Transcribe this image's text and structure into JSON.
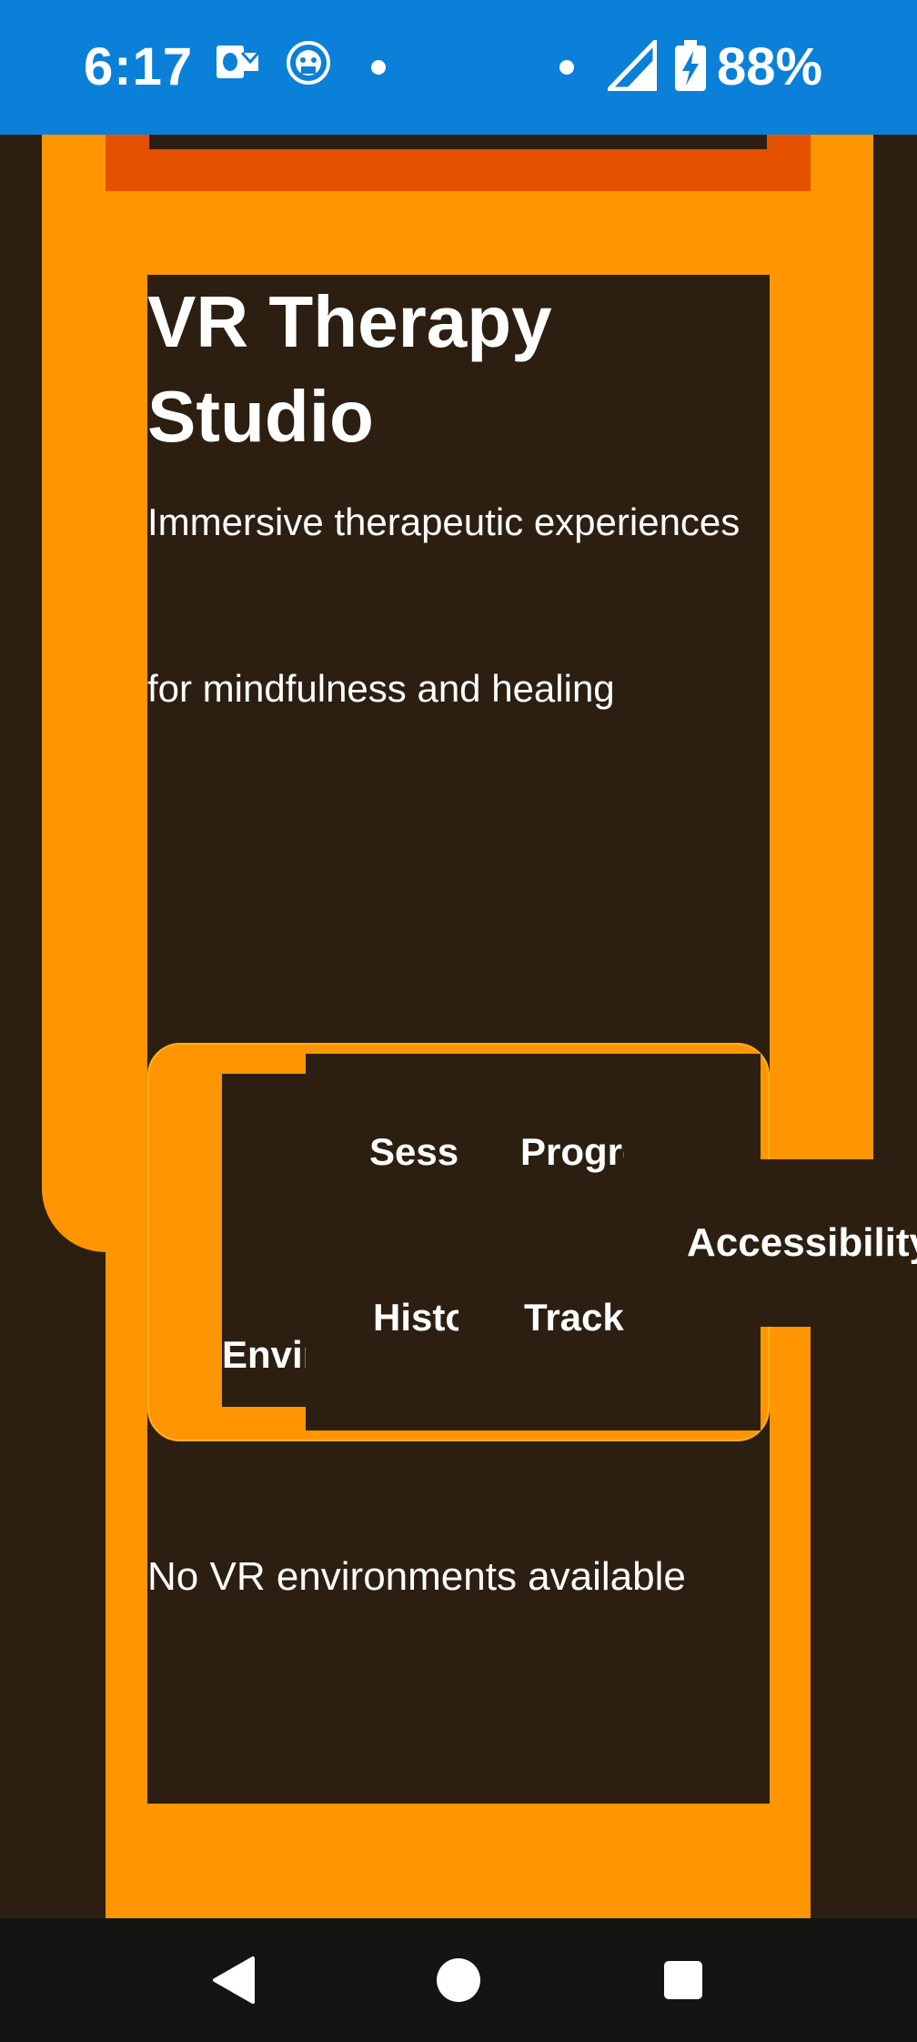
{
  "status_bar": {
    "time": "6:17",
    "battery_percent": "88%",
    "background_color": "#0b80d9",
    "icons": [
      "outlook-icon",
      "screen-record-icon",
      "notification-dot-icon",
      "signal-icon",
      "battery-charging-icon"
    ]
  },
  "page": {
    "title": "VR Therapy Studio",
    "subtitle": "Immersive therapeutic experiences for mindfulness and healing",
    "accent_color": "#ff9500",
    "background_color": "#2c1f11"
  },
  "tabs": {
    "environments": "Environments",
    "sessions": "Sessions",
    "history": "History",
    "progress": "Progress",
    "tracking": "Tracking",
    "accessibility": "Accessibility"
  },
  "content": {
    "empty_message": "No VR environments available"
  },
  "nav_bar": {
    "icons": [
      "back-icon",
      "home-icon",
      "recents-icon"
    ]
  }
}
